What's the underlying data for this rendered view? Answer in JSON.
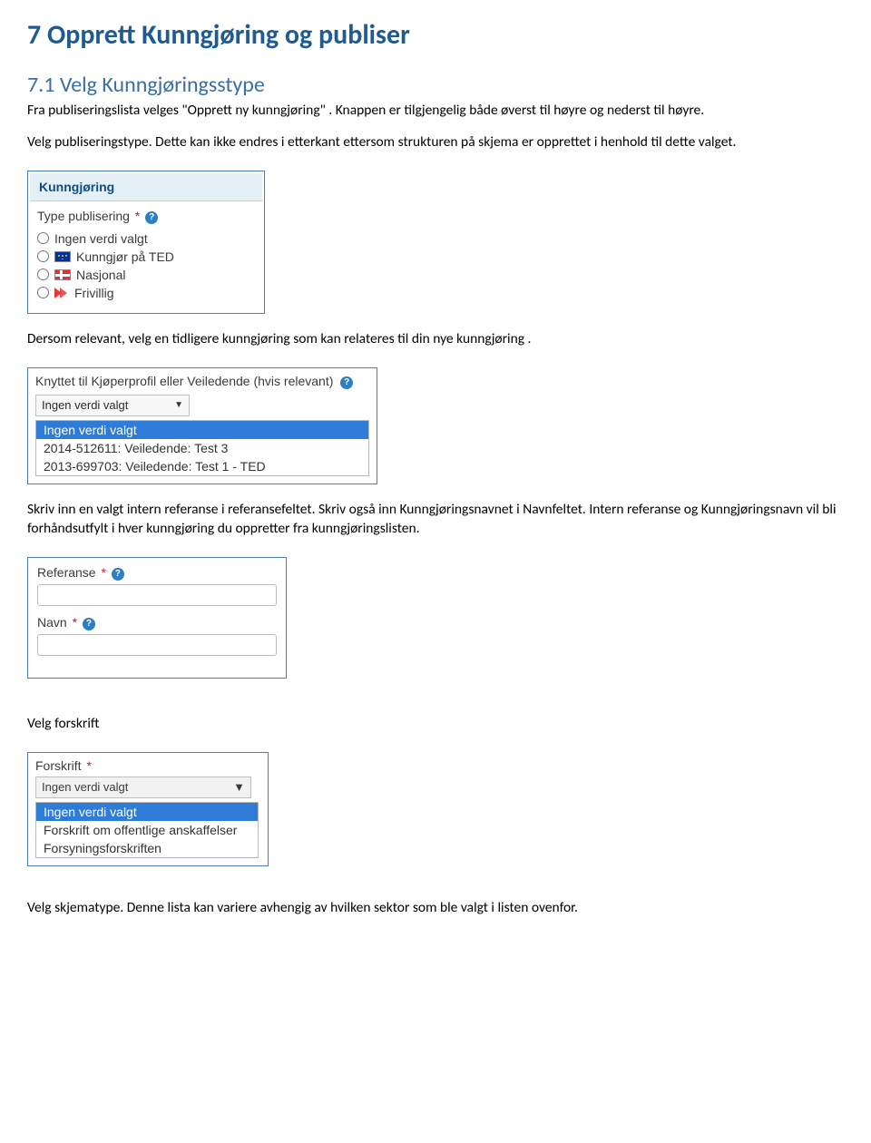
{
  "heading": "7 Opprett Kunngjøring og publiser",
  "sec1": {
    "subheading": "7.1 Velg Kunngjøringsstype",
    "p1": "Fra publiseringslista velges \"Opprett ny kunngjøring\" . Knappen er tilgjengelig både øverst til høyre og nederst til høyre.",
    "p2": "Velg publiseringstype. Dette kan ikke endres i etterkant ettersom strukturen på skjema er opprettet i henhold til dette valget."
  },
  "shot1": {
    "panel_title": "Kunngjøring",
    "label": "Type publisering",
    "req": "*",
    "options": [
      {
        "label": "Ingen verdi valgt",
        "icon": null
      },
      {
        "label": "Kunngjør på TED",
        "icon": "eu"
      },
      {
        "label": "Nasjonal",
        "icon": "no"
      },
      {
        "label": "Frivillig",
        "icon": "friv"
      }
    ]
  },
  "para_after_shot1": "Dersom relevant, velg en tidligere kunngjøring som kan relateres til din nye kunngjøring .",
  "shot2": {
    "label": "Knyttet til Kjøperprofil eller Veiledende (hvis relevant)",
    "closed_value": "Ingen verdi valgt",
    "options": [
      {
        "label": "Ingen verdi valgt",
        "selected": true
      },
      {
        "label": "2014-512611: Veiledende: Test 3",
        "selected": false
      },
      {
        "label": "2013-699703: Veiledende: Test 1 - TED",
        "selected": false
      }
    ]
  },
  "para_after_shot2": "Skriv inn en  valgt intern referanse i referansefeltet. Skriv også inn Kunngjøringsnavnet i Navnfeltet. Intern referanse og Kunngjøringsnavn vil  bli forhåndsutfylt  i hver kunngjøring du oppretter fra kunngjøringslisten.",
  "shot3": {
    "ref_label": "Referanse",
    "navn_label": "Navn",
    "req": "*",
    "ref_value": "",
    "navn_value": ""
  },
  "velg_forskrift_label": "Velg forskrift",
  "shot4": {
    "label": "Forskrift",
    "req": "*",
    "closed_value": "Ingen verdi valgt",
    "options": [
      {
        "label": "Ingen verdi valgt",
        "selected": true
      },
      {
        "label": "Forskrift om offentlige anskaffelser",
        "selected": false
      },
      {
        "label": "Forsyningsforskriften",
        "selected": false
      }
    ]
  },
  "last_para": "Velg skjematype. Denne lista kan variere avhengig av hvilken sektor som ble valgt i listen ovenfor.",
  "help_glyph": "?"
}
